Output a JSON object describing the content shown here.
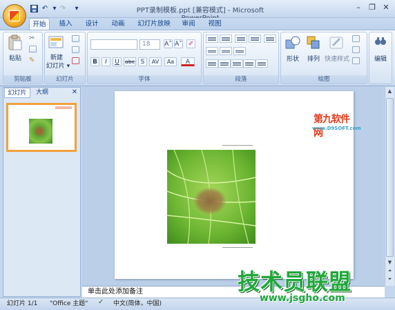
{
  "window": {
    "title": "PPT录制模板.ppt [兼容模式] - Microsoft PowerPoint",
    "minimize": "–",
    "restore": "❐",
    "close": "✕"
  },
  "qat": {
    "save_icon": "save-icon",
    "undo": "↶",
    "redo": "↷",
    "dropdown": "▾"
  },
  "tabs": [
    "开始",
    "插入",
    "设计",
    "动画",
    "幻灯片放映",
    "审阅",
    "视图"
  ],
  "active_tab": "开始",
  "ribbon": {
    "clipboard": {
      "label": "剪贴板",
      "paste": "粘贴"
    },
    "slides": {
      "label": "幻灯片",
      "new_slide_1": "新建",
      "new_slide_2": "幻灯片 ▾"
    },
    "font": {
      "label": "字体",
      "font_name": "",
      "font_size": "18",
      "bold": "B",
      "italic": "I",
      "underline": "U",
      "strike": "abc",
      "shadow": "S",
      "spacing": "AV",
      "case": "Aa",
      "color": "A",
      "grow": "A˄",
      "shrink": "A˅"
    },
    "paragraph": {
      "label": "段落"
    },
    "drawing": {
      "label": "绘图",
      "shapes": "形状",
      "arrange": "排列",
      "quick_styles": "快速样式"
    },
    "editing": {
      "label": "编辑"
    }
  },
  "left_pane": {
    "tab_slides": "幻灯片",
    "tab_outline": "大纲",
    "close": "✕",
    "slide_number": "1"
  },
  "notes_placeholder": "单击此处添加备注",
  "status": {
    "slide": "幻灯片 1/1",
    "theme": "\"Office 主题\"",
    "language": "中文(简体，中国)"
  },
  "watermarks": {
    "top_brand": "第九软件网",
    "top_url": "www.D9SOFT.com",
    "bottom_brand": "技术员联盟",
    "bottom_url": "www.jsgho.com"
  },
  "colors": {
    "accent": "#1fa83a",
    "brand_red": "#e23c1c",
    "ribbon": "#dbe7f6"
  }
}
